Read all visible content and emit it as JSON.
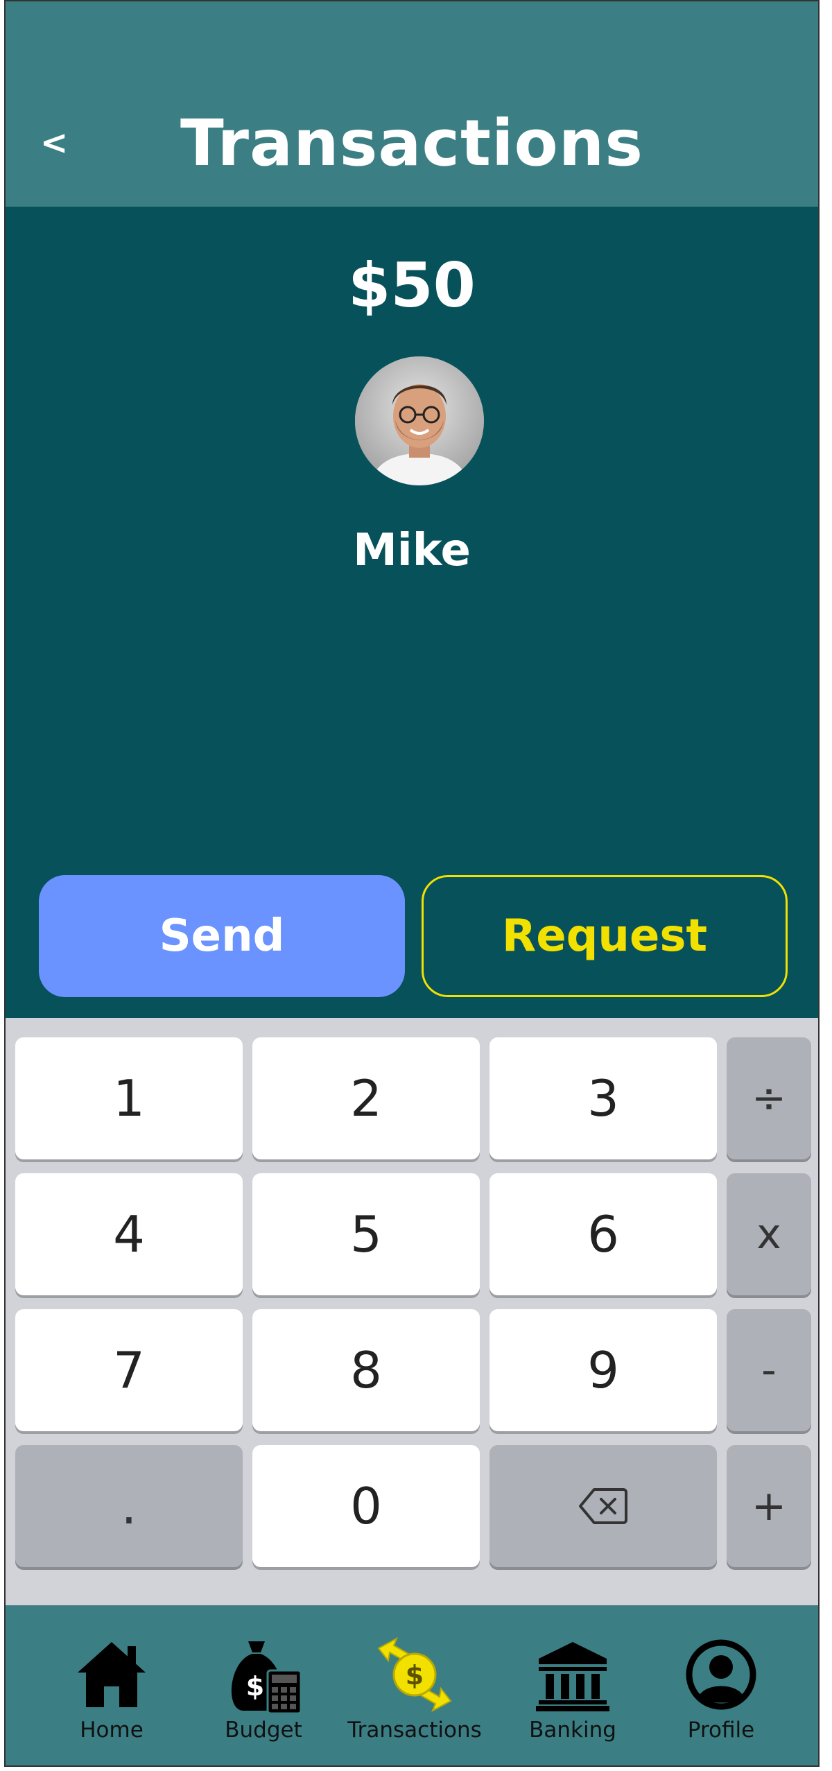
{
  "header": {
    "back_glyph": "<",
    "title": "Transactions"
  },
  "transaction": {
    "amount": "$50",
    "recipient": "Mike"
  },
  "actions": {
    "send_label": "Send",
    "request_label": "Request"
  },
  "keypad": {
    "row1": [
      "1",
      "2",
      "3",
      "÷"
    ],
    "row2": [
      "4",
      "5",
      "6",
      "x"
    ],
    "row3": [
      "7",
      "8",
      "9",
      "-"
    ],
    "row4": [
      ".",
      "0",
      "+"
    ],
    "backspace_icon": "backspace-icon"
  },
  "nav": {
    "items": [
      {
        "label": "Home",
        "icon": "home-icon"
      },
      {
        "label": "Budget",
        "icon": "money-bag-calculator-icon"
      },
      {
        "label": "Transactions",
        "icon": "transfer-dollar-icon"
      },
      {
        "label": "Banking",
        "icon": "bank-icon"
      },
      {
        "label": "Profile",
        "icon": "user-circle-icon"
      }
    ]
  },
  "colors": {
    "header_bg": "#3b7f84",
    "body_bg": "#07525a",
    "send_bg": "#6a93ff",
    "request_accent": "#f2e000",
    "nav_active_accent": "#f2e000"
  }
}
